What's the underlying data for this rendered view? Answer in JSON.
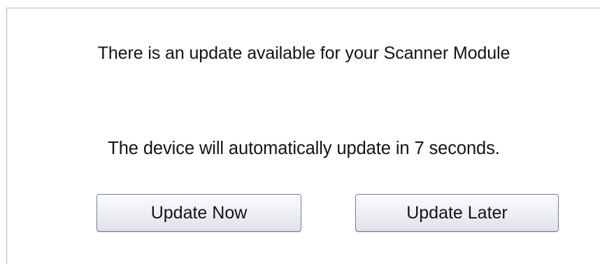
{
  "dialog": {
    "message_available": "There is an update available for your Scanner Module",
    "message_countdown": "The device will automatically update in 7 seconds.",
    "buttons": {
      "update_now": "Update Now",
      "update_later": "Update Later"
    }
  }
}
